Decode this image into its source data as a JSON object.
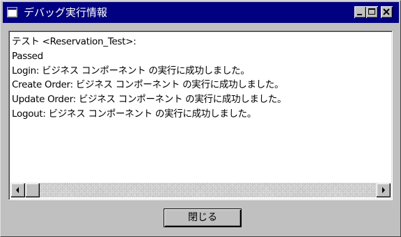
{
  "window": {
    "title": "デバッグ実行情報"
  },
  "titlebar_buttons": {
    "minimize": "minimize-icon",
    "maximize": "maximize-icon",
    "close": "close-icon"
  },
  "output": {
    "lines": [
      "テスト <Reservation_Test>:",
      "Passed",
      "Login: ビジネス コンポーネント の実行に成功しました。",
      "Create Order: ビジネス コンポーネント の実行に成功しました。",
      "Update Order: ビジネス コンポーネント の実行に成功しました。",
      "Logout: ビジネス コンポーネント の実行に成功しました。"
    ]
  },
  "scrollbar": {
    "left_arrow": "arrow-left-icon",
    "right_arrow": "arrow-right-icon"
  },
  "footer": {
    "close_label": "閉じる"
  },
  "colors": {
    "titlebar": "#000080",
    "face": "#c0c0c0"
  }
}
